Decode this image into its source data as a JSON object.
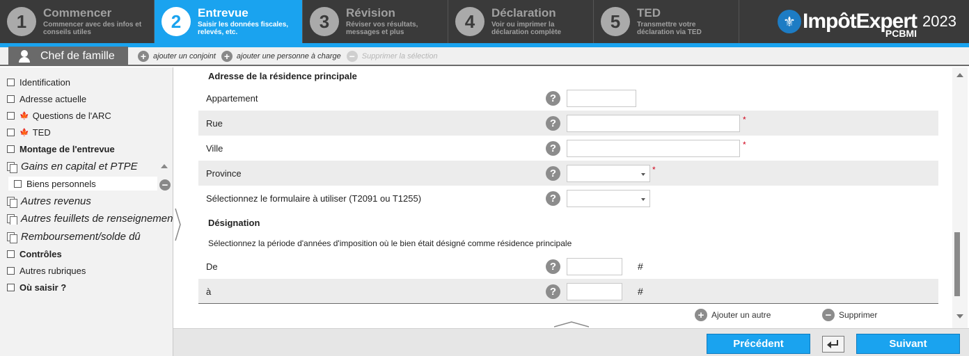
{
  "steps": [
    {
      "num": "1",
      "title": "Commencer",
      "desc": "Commencer avec des infos et conseils utiles",
      "active": false
    },
    {
      "num": "2",
      "title": "Entrevue",
      "desc": "Saisir les données fiscales, relevés, etc.",
      "active": true
    },
    {
      "num": "3",
      "title": "Révision",
      "desc": "Réviser vos résultats, messages et plus",
      "active": false
    },
    {
      "num": "4",
      "title": "Déclaration",
      "desc": "Voir ou imprimer la déclaration complète",
      "active": false
    },
    {
      "num": "5",
      "title": "TED",
      "desc": "Transmettre votre déclaration via TED",
      "active": false
    }
  ],
  "logo": {
    "name": "ImpôtExpert",
    "sub": "PCBMI",
    "year": "2023",
    "icon": "fleur-de-lis-icon"
  },
  "toolbar": {
    "chef_label": "Chef de famille",
    "add_spouse": "ajouter un conjoint",
    "add_dependent": "ajouter une personne à charge",
    "delete_selection": "Supprimer la sélection"
  },
  "sidebar": {
    "items": [
      {
        "label": "Identification",
        "type": "checkbox"
      },
      {
        "label": "Adresse actuelle",
        "type": "checkbox"
      },
      {
        "label": "Questions de l'ARC",
        "type": "checkbox-leaf"
      },
      {
        "label": "TED",
        "type": "checkbox-leaf"
      },
      {
        "label": "Montage de l'entrevue",
        "type": "checkbox-bold"
      },
      {
        "label": "Gains en capital et PTPE",
        "type": "section"
      },
      {
        "label": "Biens personnels",
        "type": "sub"
      },
      {
        "label": "Autres revenus",
        "type": "section"
      },
      {
        "label": "Autres feuillets de renseignements",
        "type": "section"
      },
      {
        "label": "Remboursement/solde dû",
        "type": "section"
      },
      {
        "label": "Contrôles",
        "type": "checkbox-bold"
      },
      {
        "label": "Autres rubriques",
        "type": "checkbox"
      },
      {
        "label": "Où saisir ?",
        "type": "checkbox-bold"
      }
    ]
  },
  "form": {
    "section_address": "Adresse de la résidence principale",
    "fields": {
      "apartment": {
        "label": "Appartement",
        "value": ""
      },
      "street": {
        "label": "Rue",
        "value": ""
      },
      "city": {
        "label": "Ville",
        "value": ""
      },
      "province": {
        "label": "Province",
        "value": ""
      },
      "form_choice": {
        "label": "Sélectionnez le formulaire à utiliser (T2091 ou T1255)",
        "value": ""
      }
    },
    "section_designation": "Désignation",
    "designation_note": "Sélectionnez la période d'années d'imposition où le bien était désigné comme résidence principale",
    "from": {
      "label": "De",
      "value": "",
      "suffix": "#"
    },
    "to": {
      "label": "à",
      "value": "",
      "suffix": "#"
    },
    "required_mark": "*",
    "help_glyph": "?",
    "add_another": "Ajouter un autre",
    "delete": "Supprimer"
  },
  "footer": {
    "previous": "Précédent",
    "next": "Suivant"
  },
  "colors": {
    "accent": "#1aa3ef",
    "header_bg": "#3a3a3a",
    "required": "#d0021b"
  }
}
